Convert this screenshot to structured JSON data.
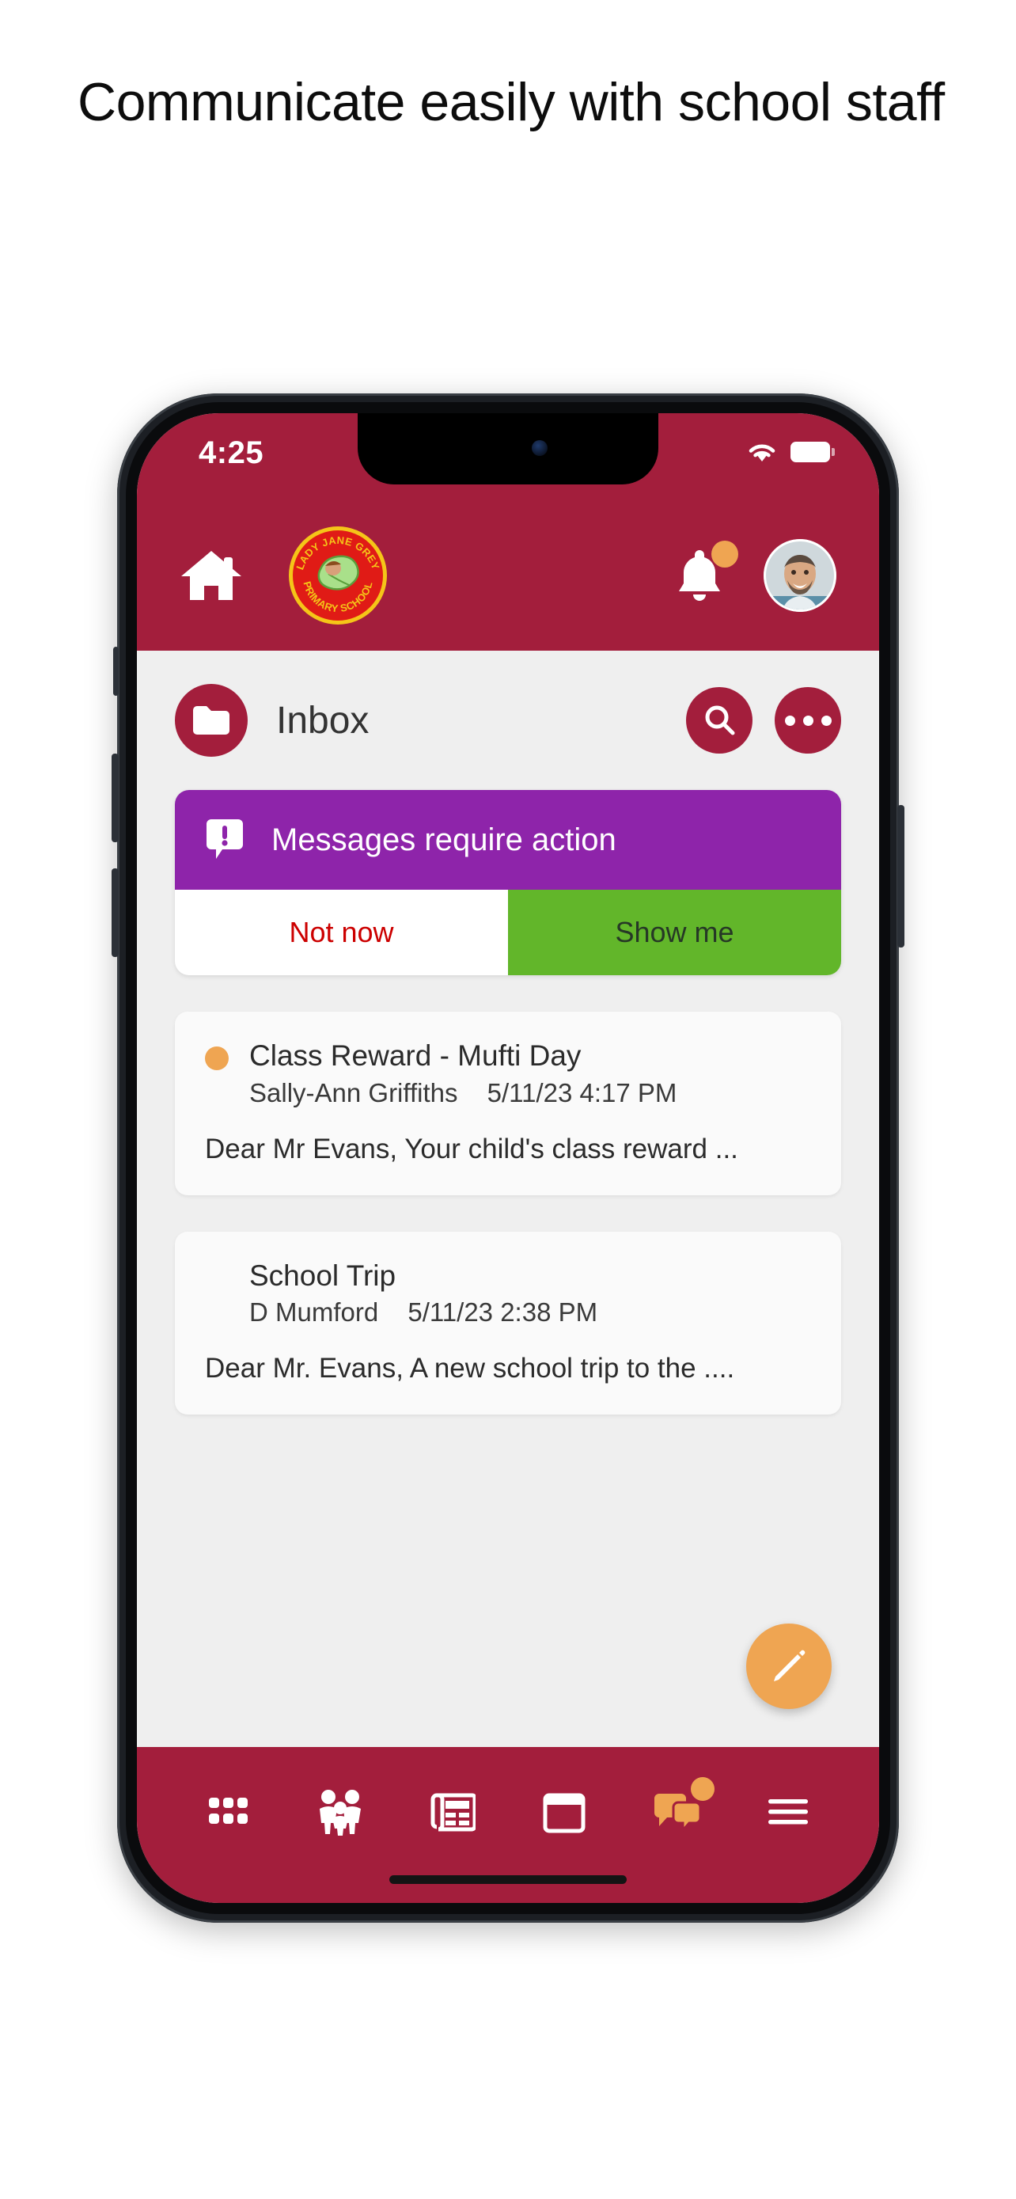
{
  "headline": "Communicate easily with school staff",
  "phone": {
    "status_bar": {
      "time": "4:25",
      "wifi_icon": "wifi-icon",
      "battery_icon": "battery-icon"
    },
    "app_header": {
      "home_icon": "home-icon",
      "logo_text_top": "LADY JANE GREY",
      "logo_text_bottom": "PRIMARY SCHOOL",
      "bell_icon": "bell-icon",
      "bell_badge": "notification-badge",
      "avatar": "user-avatar"
    },
    "inbox": {
      "folder_icon": "folder-icon",
      "title": "Inbox",
      "search_icon": "search-icon",
      "more_icon": "more-options-icon"
    },
    "alert": {
      "icon": "alert-message-icon",
      "text": "Messages require action",
      "dismiss_label": "Not now",
      "confirm_label": "Show me",
      "dismiss_color": "#cc0000",
      "confirm_bg": "#62b62a",
      "banner_bg": "#8e24aa"
    },
    "messages": [
      {
        "unread": true,
        "subject": "Class Reward - Mufti Day",
        "sender": "Sally-Ann Griffiths",
        "timestamp": "5/11/23 4:17 PM",
        "preview": "Dear Mr Evans, Your child's class reward ..."
      },
      {
        "unread": false,
        "subject": "School Trip",
        "sender": "D Mumford",
        "timestamp": "5/11/23 2:38 PM",
        "preview": "Dear Mr. Evans, A new school trip to the ...."
      }
    ],
    "compose_fab": "compose-pencil-icon",
    "bottom_nav": [
      {
        "icon": "apps-grid-icon",
        "badge": false
      },
      {
        "icon": "family-icon",
        "badge": false
      },
      {
        "icon": "newsletter-icon",
        "badge": false
      },
      {
        "icon": "calendar-icon",
        "badge": false
      },
      {
        "icon": "messages-icon",
        "badge": true
      },
      {
        "icon": "menu-hamburger-icon",
        "badge": false
      }
    ]
  },
  "colors": {
    "brand_crimson": "#a31e3c",
    "accent_orange": "#efa552",
    "alert_purple": "#8e24aa",
    "action_green": "#62b62a",
    "screen_bg": "#efefef"
  }
}
